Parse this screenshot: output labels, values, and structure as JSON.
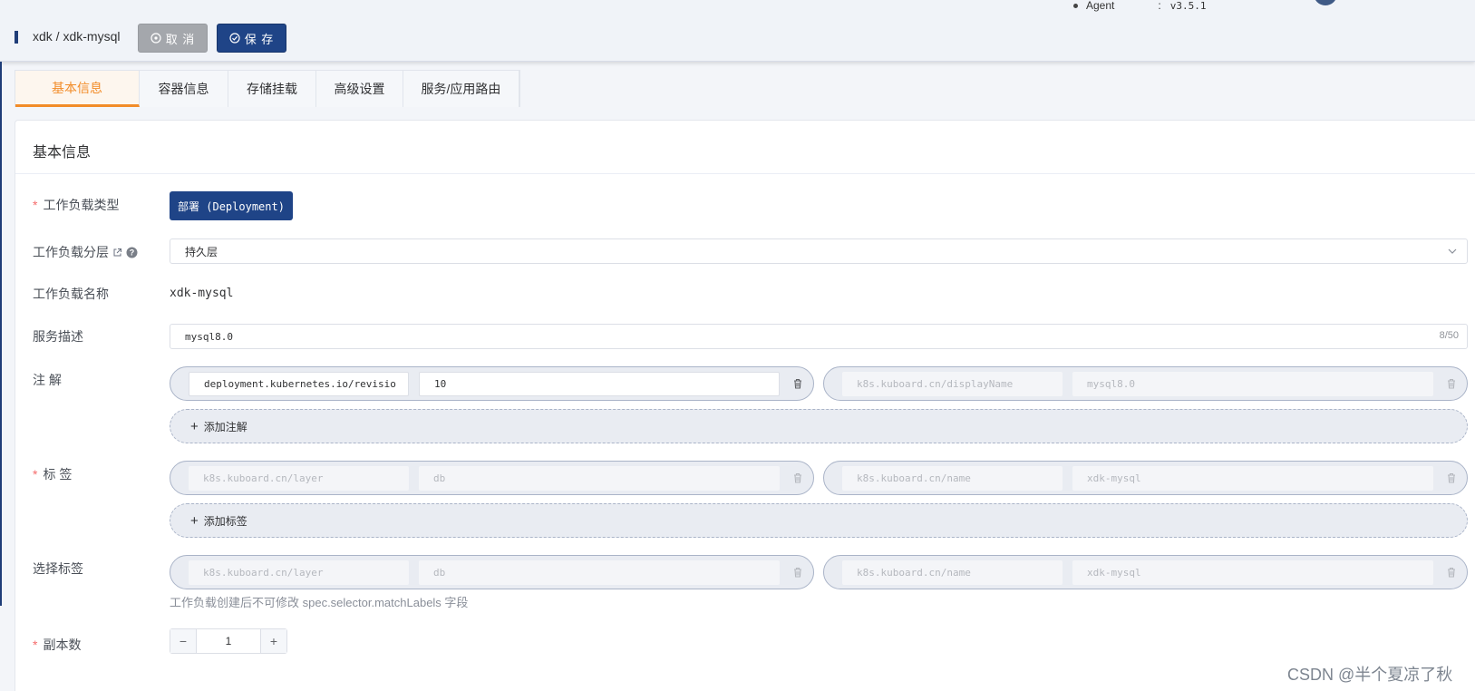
{
  "header": {
    "agent_label": "Agent",
    "agent_colon": ":",
    "agent_version": "v3.5.1",
    "breadcrumb": "xdk / xdk-mysql",
    "cancel_label": "取 消",
    "save_label": "保 存"
  },
  "tabs": [
    {
      "label": "基本信息",
      "active": true
    },
    {
      "label": "容器信息",
      "active": false
    },
    {
      "label": "存储挂载",
      "active": false
    },
    {
      "label": "高级设置",
      "active": false
    },
    {
      "label": "服务/应用路由",
      "active": false
    }
  ],
  "section": {
    "title": "基本信息"
  },
  "form": {
    "workload_type": {
      "label": "工作负载类型",
      "value": "部署 (Deployment)"
    },
    "workload_layer": {
      "label": "工作负载分层",
      "value": "持久层"
    },
    "workload_name": {
      "label": "工作负载名称",
      "value": "xdk-mysql"
    },
    "description": {
      "label": "服务描述",
      "value": "mysql8.0",
      "counter": "8/50"
    },
    "annotations": {
      "label": "注 解",
      "items": [
        {
          "key": "deployment.kubernetes.io/revisio",
          "value": "10"
        },
        {
          "key": "k8s.kuboard.cn/displayName",
          "value": "mysql8.0"
        }
      ],
      "add_label": "添加注解"
    },
    "labels": {
      "label": "标 签",
      "items": [
        {
          "key": "k8s.kuboard.cn/layer",
          "value": "db"
        },
        {
          "key": "k8s.kuboard.cn/name",
          "value": "xdk-mysql"
        }
      ],
      "add_label": "添加标签"
    },
    "selector": {
      "label": "选择标签",
      "items": [
        {
          "key": "k8s.kuboard.cn/layer",
          "value": "db"
        },
        {
          "key": "k8s.kuboard.cn/name",
          "value": "xdk-mysql"
        }
      ],
      "hint": "工作负载创建后不可修改 spec.selector.matchLabels 字段"
    },
    "replicas": {
      "label": "副本数",
      "value": "1",
      "minus": "−",
      "plus": "+"
    }
  },
  "watermark": "CSDN @半个夏凉了秋",
  "colors": {
    "primary": "#1f4487",
    "accent": "#f28c28",
    "required": "#f56c6c"
  }
}
